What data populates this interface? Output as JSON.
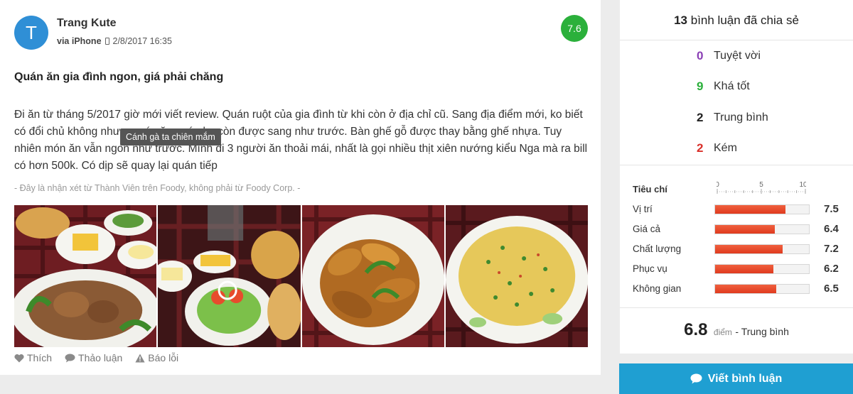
{
  "review": {
    "avatar_letter": "T",
    "user_name": "Trang Kute",
    "via_label": "via iPhone",
    "date": "2/8/2017 16:35",
    "score": "7.6",
    "title": "Quán ăn gia đình ngon, giá phải chăng",
    "body": "Đi ăn từ tháng 5/2017 giờ mới viết review. Quán ruột của gia đình từ khi còn ở địa chỉ cũ. Sang địa điểm mới, ko biết có đổi chủ không nhưng món ăn quán ko còn được sang như trước. Bàn ghế gỗ được thay bằng ghế nhựa. Tuy nhiên món ăn vẫn ngon như trước. Mình đi 3 người ăn thoải mái, nhất là gọi nhiều thịt xiên nướng kiểu Nga mà ra bill có hơn 500k. Có dịp sẽ quay lại quán tiếp",
    "tooltip": "Cánh gà ta chiên mắm",
    "disclaimer": "- Đây là nhận xét từ Thành Viên trên Foody, không phải từ Foody Corp. -",
    "actions": {
      "like": "Thích",
      "discuss": "Thảo luận",
      "report": "Báo lỗi"
    },
    "score_color": "#2bb03b"
  },
  "summary": {
    "count": "13",
    "count_label": "bình luận đã chia sẻ",
    "tally": [
      {
        "n": "0",
        "label": "Tuyệt vời",
        "color": "#8a3fb5"
      },
      {
        "n": "9",
        "label": "Khá tốt",
        "color": "#2bb03b"
      },
      {
        "n": "2",
        "label": "Trung bình",
        "color": "#222222"
      },
      {
        "n": "2",
        "label": "Kém",
        "color": "#d9302a"
      }
    ],
    "criteria_heading": "Tiêu chí",
    "scale_labels": [
      "0",
      "5",
      "10"
    ],
    "criteria": [
      {
        "label": "Vị trí",
        "value": 7.5,
        "display": "7.5"
      },
      {
        "label": "Giá cả",
        "value": 6.4,
        "display": "6.4"
      },
      {
        "label": "Chất lượng",
        "value": 7.2,
        "display": "7.2"
      },
      {
        "label": "Phục vụ",
        "value": 6.2,
        "display": "6.2"
      },
      {
        "label": "Không gian",
        "value": 6.5,
        "display": "6.5"
      }
    ],
    "overall_score": "6.8",
    "overall_unit": "điểm",
    "overall_desc": "- Trung bình",
    "write_button": "Viết bình luận"
  }
}
